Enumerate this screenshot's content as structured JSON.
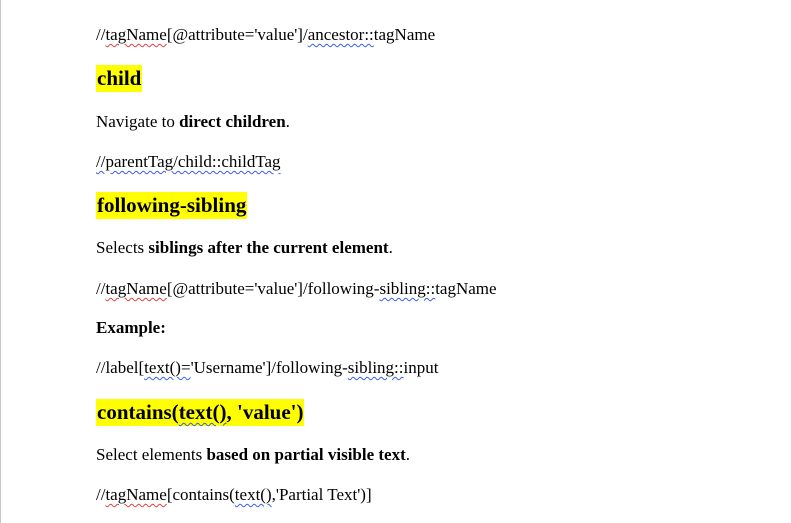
{
  "document": {
    "p1": {
      "a": "//",
      "b": "tagName",
      "c": "[@attribute='value']/",
      "d": "ancestor::",
      "e": "tagName"
    },
    "h_child": "child",
    "p2": {
      "a": "Navigate to ",
      "b": "direct children",
      "c": "."
    },
    "p3": {
      "a": "//parentTag/child::childTag"
    },
    "h_following": "following-sibling",
    "p4": {
      "a": "Selects ",
      "b": "siblings after the current element",
      "c": "."
    },
    "p5": {
      "a": "//",
      "b": "tagName",
      "c": "[@attribute='value']/following-",
      "d": "sibling::",
      "e": "tagName"
    },
    "p6": {
      "a": "Example:"
    },
    "p7": {
      "a": "//label[",
      "b": "text()=",
      "c": "'Username']/following-",
      "d": "sibling::",
      "e": "input"
    },
    "h_contains": {
      "a": "contains(",
      "b": "text()",
      "c": ", 'value')"
    },
    "p8": {
      "a": "Select elements ",
      "b": "based on partial visible text",
      "c": "."
    },
    "p9": {
      "a": "//",
      "b": "tagName",
      "c": "[contains(",
      "d": "text()",
      "e": ",'Partial Text')]"
    }
  }
}
